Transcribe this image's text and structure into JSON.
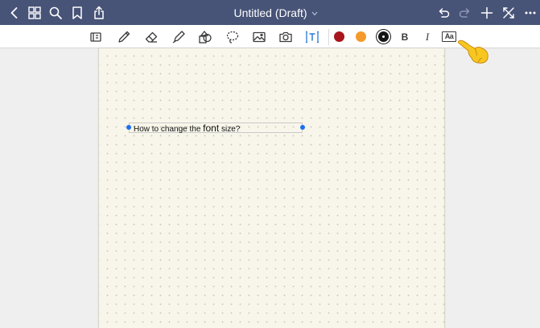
{
  "navbar": {
    "title": "Untitled (Draft)",
    "background": "#475377",
    "left_icons": [
      "back-icon",
      "grid-icon",
      "search-icon",
      "bookmark-icon",
      "share-icon"
    ],
    "right_icons": [
      "undo-icon",
      "redo-icon",
      "add-icon",
      "close-fullscreen-icon",
      "more-icon"
    ]
  },
  "toolbar": {
    "tools": [
      "keyboard-icon",
      "pen-icon",
      "eraser-icon",
      "highlighter-icon",
      "shapes-icon",
      "lasso-icon",
      "image-icon",
      "camera-icon",
      "text-tool-icon"
    ],
    "colors": [
      {
        "name": "dark-red",
        "hex": "#a8151c"
      },
      {
        "name": "orange",
        "hex": "#f39a2b"
      },
      {
        "name": "black",
        "hex": "#151515",
        "selected": true
      }
    ],
    "bold_label": "B",
    "italic_label": "I",
    "font_size_label": "Aa"
  },
  "document": {
    "textbox": {
      "text_before": "How to change the ",
      "text_large": "font",
      "text_after": " size?"
    }
  },
  "overlay": {
    "pointer": "pointing-hand-emoji"
  }
}
